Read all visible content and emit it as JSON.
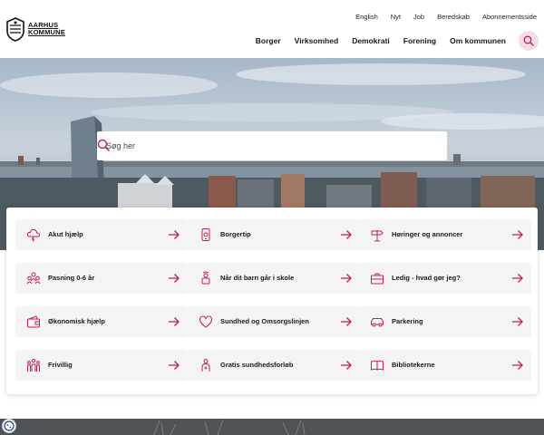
{
  "header": {
    "logo_line1": "AARHUS",
    "logo_line2": "KOMMUNE",
    "utility_links": [
      "English",
      "Nyt",
      "Job",
      "Beredskab",
      "Abonnementsside"
    ],
    "main_links": [
      "Borger",
      "Virksomhed",
      "Demokrati",
      "Forening",
      "Om kommunen"
    ],
    "search_icon": "search-icon"
  },
  "hero": {
    "search_placeholder": "Søg her",
    "search_icon": "search-icon"
  },
  "quick_links": [
    {
      "label": "Akut hjælp",
      "icon": "storm-cloud-icon"
    },
    {
      "label": "Borgertip",
      "icon": "phone-icon"
    },
    {
      "label": "Høringer og annoncer",
      "icon": "signpost-icon"
    },
    {
      "label": "Pasning 0-6 år",
      "icon": "group-icon"
    },
    {
      "label": "Når dit barn går i skole",
      "icon": "school-icon"
    },
    {
      "label": "Ledig - hvad gør jeg?",
      "icon": "briefcase-icon"
    },
    {
      "label": "Økonomisk hjælp",
      "icon": "wallet-icon"
    },
    {
      "label": "Sundhed og Omsorgslinjen",
      "icon": "heart-icon"
    },
    {
      "label": "Parkering",
      "icon": "car-icon"
    },
    {
      "label": "Frivillig",
      "icon": "volunteers-icon"
    },
    {
      "label": "Gratis sundhedsforløb",
      "icon": "health-course-icon"
    },
    {
      "label": "Bibliotekerne",
      "icon": "book-icon"
    }
  ],
  "colors": {
    "accent": "#c8195e",
    "accent_light": "#f6dbe6",
    "tile_bg": "#f4f4f4"
  }
}
